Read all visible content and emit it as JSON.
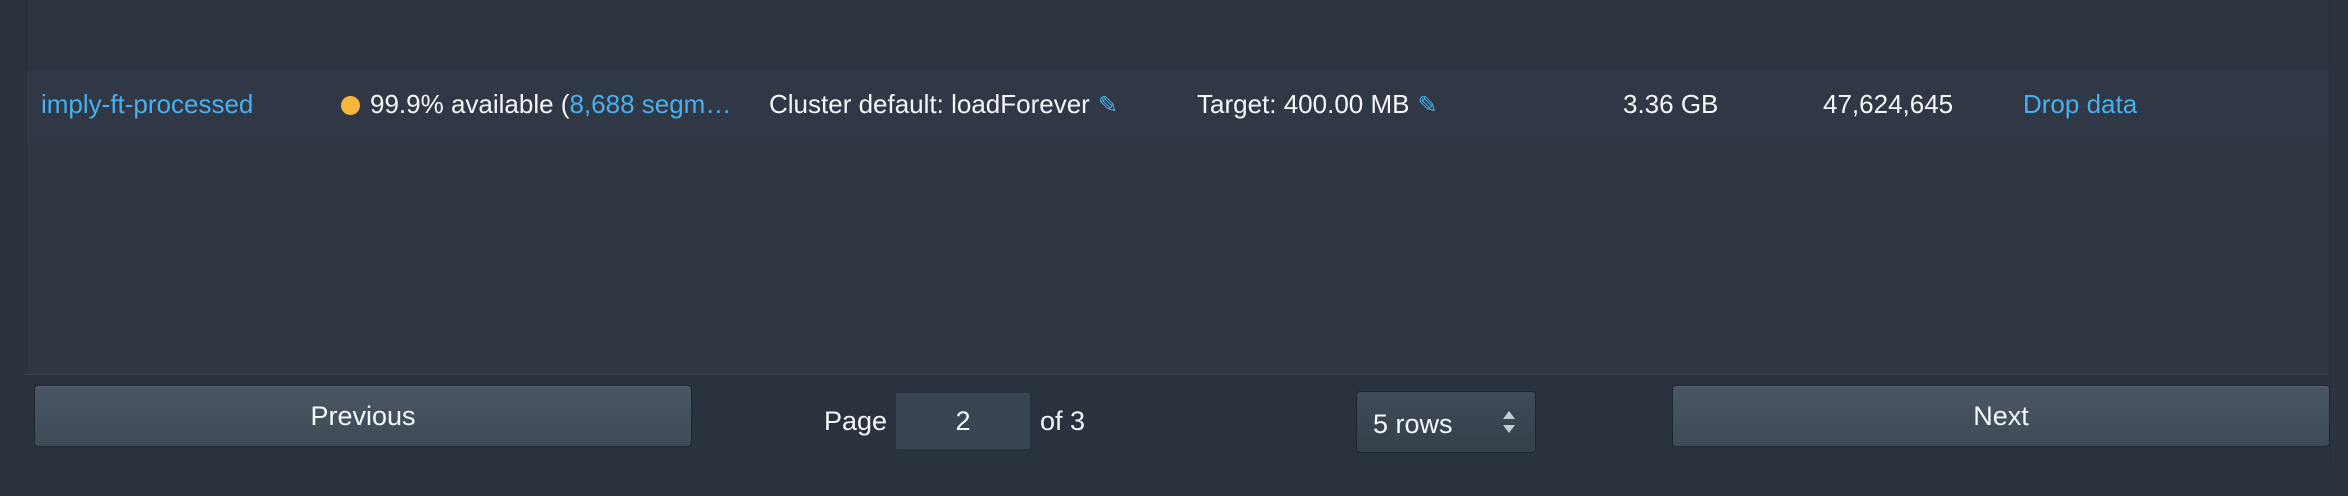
{
  "row": {
    "datasource": "imply-ft-processed",
    "availability_text": "99.9% available (",
    "availability_link": "8,688 segm…",
    "retention": "Cluster default: loadForever",
    "compaction": "Target: 400.00 MB",
    "total_size": "3.36 GB",
    "num_rows": "47,624,645",
    "action": "Drop data",
    "status_color": "#f5b83d"
  },
  "pagination": {
    "previous_label": "Previous",
    "page_label": "Page",
    "current_page": "2",
    "of_label": "of 3",
    "rows_select": "5 rows",
    "next_label": "Next"
  },
  "icons": {
    "edit": "pencil-icon",
    "status": "status-dot-icon",
    "select": "sort-arrows-icon"
  },
  "colors": {
    "link": "#48aff0",
    "background": "#2b333e",
    "text": "#f5f8fa"
  }
}
